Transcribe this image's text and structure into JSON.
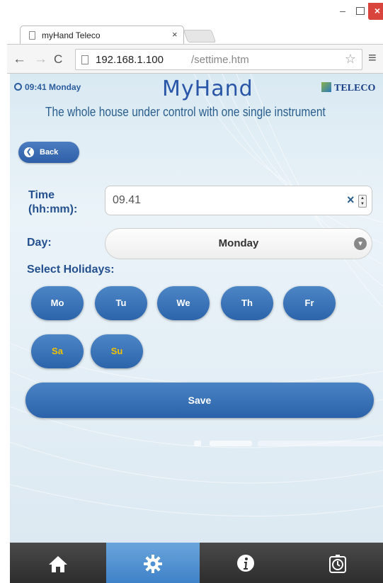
{
  "browser": {
    "tab_title": "myHand Teleco",
    "tab_close": "×",
    "url_host": "192.168.1.100",
    "url_path": "/settime.htm",
    "win_min": "–",
    "win_close": "×"
  },
  "header": {
    "clock_time": "09:41 Monday",
    "brand": "MyHand",
    "company": "TELECO",
    "tagline": "The whole house under control with one single instrument"
  },
  "back_label": "Back",
  "form": {
    "time_label_1": "Time",
    "time_label_2": "(hh:mm):",
    "time_value": "09.41",
    "day_label": "Day:",
    "day_value": "Monday",
    "holidays_label": "Select Holidays:"
  },
  "days": [
    "Mo",
    "Tu",
    "We",
    "Th",
    "Fr",
    "Sa",
    "Su"
  ],
  "save_label": "Save",
  "tabbar": [
    "home-icon",
    "gear-icon",
    "info-icon",
    "timer-icon"
  ],
  "colors": {
    "accent": "#2c64ab",
    "weekend_text": "#f2c200",
    "active_tab": "#4f90d2",
    "close_button": "#d9453c"
  }
}
